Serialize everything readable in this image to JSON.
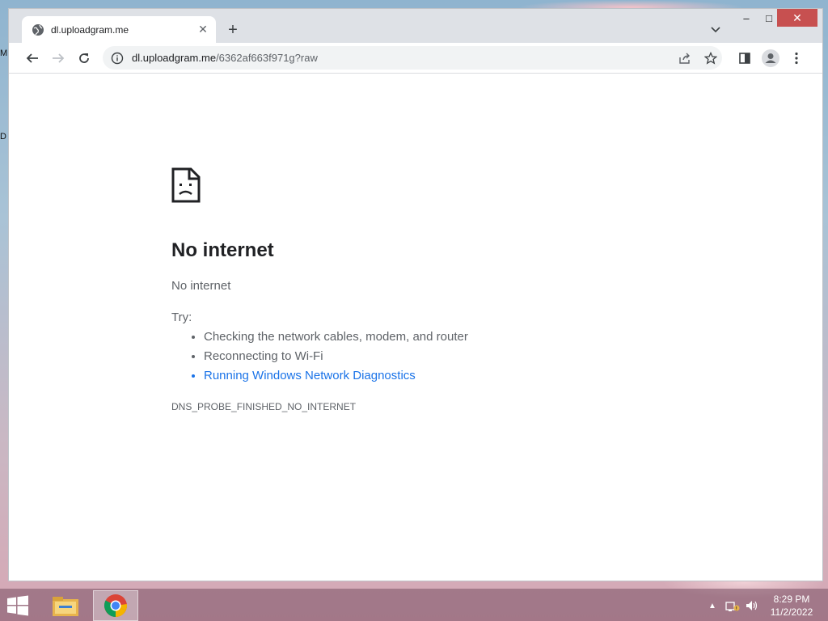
{
  "desktop": {
    "fragments": [
      "M",
      "D"
    ]
  },
  "browser": {
    "tab": {
      "title": "dl.uploadgram.me",
      "favicon": "globe-icon",
      "close_glyph": "✕"
    },
    "new_tab_glyph": "+",
    "window_controls": {
      "minimize_glyph": "–",
      "maximize_glyph": "□",
      "close_glyph": "✕"
    },
    "toolbar": {
      "url_host": "dl.uploadgram.me",
      "url_path": "/6362af663f971g?raw"
    }
  },
  "error_page": {
    "title": "No internet",
    "subtitle": "No internet",
    "try_label": "Try:",
    "suggestions": [
      "Checking the network cables, modem, and router",
      "Reconnecting to Wi-Fi",
      "Running Windows Network Diagnostics"
    ],
    "error_code": "DNS_PROBE_FINISHED_NO_INTERNET"
  },
  "taskbar": {
    "apps": [
      "file-explorer-icon",
      "chrome-icon"
    ],
    "time": "8:29 PM",
    "date": "11/2/2022"
  },
  "colors": {
    "link": "#1a73e8",
    "text_secondary": "#5f6368",
    "text_primary": "#202124",
    "close_red": "#c75050"
  }
}
